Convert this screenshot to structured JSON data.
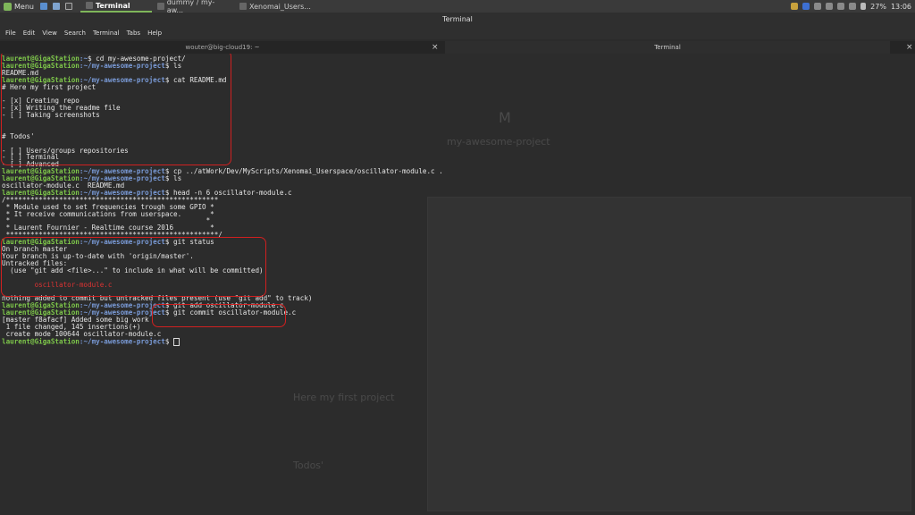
{
  "panel": {
    "menu_label": "Menu",
    "tasks": [
      {
        "label": "Terminal",
        "active": true
      },
      {
        "label": "dummy / my-aw...",
        "active": false
      },
      {
        "label": "Xenomai_Users...",
        "active": false
      }
    ],
    "battery": "27%",
    "time": "13:06"
  },
  "window": {
    "title": "Terminal",
    "menus": [
      "File",
      "Edit",
      "View",
      "Search",
      "Terminal",
      "Tabs",
      "Help"
    ],
    "tabs": [
      {
        "label": "wouter@big-cloud19: ~",
        "active": false
      },
      {
        "label": "Terminal",
        "active": true
      }
    ]
  },
  "terminal": {
    "lines": [
      {
        "u": "laurent@GigaStation",
        "p": ":~",
        "t": "$ cd my-awesome-project/"
      },
      {
        "u": "laurent@GigaStation",
        "p": ":~/my-awesome-project",
        "t": "$ ls"
      },
      {
        "t": "README.md"
      },
      {
        "u": "laurent@GigaStation",
        "p": ":~/my-awesome-project",
        "t": "$ cat README.md"
      },
      {
        "t": "# Here my first project"
      },
      {
        "t": ""
      },
      {
        "t": "- [x] Creating repo"
      },
      {
        "t": "- [x] Writing the readme file"
      },
      {
        "t": "- [ ] Taking screenshots"
      },
      {
        "t": ""
      },
      {
        "t": ""
      },
      {
        "t": "# Todos'"
      },
      {
        "t": ""
      },
      {
        "t": "- [ ] Users/groups repositories"
      },
      {
        "t": "- [ ] Terminal"
      },
      {
        "t": "- [ ] Advanced"
      },
      {
        "u": "laurent@GigaStation",
        "p": ":~/my-awesome-project",
        "t": "$ cp ../atWork/Dev/MyScripts/Xenomai_Userspace/oscillator-module.c ."
      },
      {
        "u": "laurent@GigaStation",
        "p": ":~/my-awesome-project",
        "t": "$ ls"
      },
      {
        "t": "oscillator-module.c  README.md"
      },
      {
        "u": "laurent@GigaStation",
        "p": ":~/my-awesome-project",
        "t": "$ head -n 6 oscillator-module.c"
      },
      {
        "t": "/****************************************************"
      },
      {
        "t": " * Module used to set frequencies trough some GPIO *"
      },
      {
        "t": " * It receive communications from userspace.       *"
      },
      {
        "t": " *                                                *"
      },
      {
        "t": " * Laurent Fournier - Realtime course 2016         *"
      },
      {
        "t": " ****************************************************/"
      },
      {
        "u": "laurent@GigaStation",
        "p": ":~/my-awesome-project",
        "t": "$ git status"
      },
      {
        "t": "On branch master"
      },
      {
        "t": "Your branch is up-to-date with 'origin/master'."
      },
      {
        "t": "Untracked files:"
      },
      {
        "t": "  (use \"git add <file>...\" to include in what will be committed)"
      },
      {
        "t": ""
      },
      {
        "t": "        oscillator-module.c",
        "red": true
      },
      {
        "t": ""
      },
      {
        "t": "nothing added to commit but untracked files present (use \"git add\" to track)"
      },
      {
        "u": "laurent@GigaStation",
        "p": ":~/my-awesome-project",
        "t": "$ git add oscillator-module.c"
      },
      {
        "u": "laurent@GigaStation",
        "p": ":~/my-awesome-project",
        "t": "$ git commit oscillator-module.c"
      },
      {
        "t": "[master f8afacf] Added some big work"
      },
      {
        "t": " 1 file changed, 145 insertions(+)"
      },
      {
        "t": " create mode 100644 oscillator-module.c"
      },
      {
        "u": "laurent@GigaStation",
        "p": ":~/my-awesome-project",
        "t": "$ ",
        "cursor": true
      }
    ]
  },
  "background_page": {
    "avatar_letter": "M",
    "project_title": "my-awesome-project",
    "readme_heading": "Here my first project",
    "todos_heading": "Todos'"
  },
  "colors": {
    "user": "#7ec84a",
    "path": "#7a9bd8",
    "untracked": "#dd3333",
    "highlight": "#d02020"
  }
}
